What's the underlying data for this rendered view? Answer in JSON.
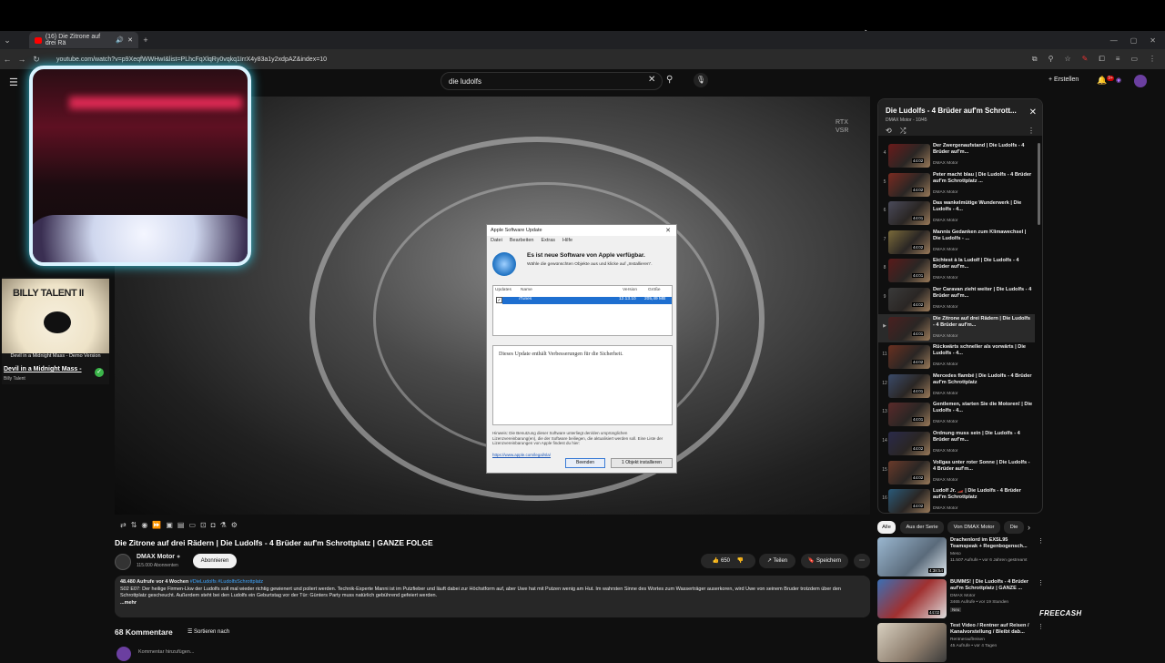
{
  "browser": {
    "tab_title": "(16) Die Zitrone auf drei Rä",
    "url": "youtube.com/watch?v=p9XeqfWWHwI&list=PLhcFqXlqRy0vqkq1IrrX4y83a1y2xdpAZ&index=10"
  },
  "header": {
    "search_value": "die ludolfs",
    "create_label": "Erstellen",
    "notif_count": "9+"
  },
  "music_widget": {
    "album_art_text": "BILLY TALENT II",
    "caption": "Devil in a Midnight Mass - Demo Version",
    "song_title": "Devil in a Midnight Mass -",
    "artist": "Billy Talent"
  },
  "video": {
    "rtx_label": "RTX\nVSR",
    "title": "Die Zitrone auf drei Rädern | Die Ludolfs - 4 Brüder auf'm Schrottplatz | GANZE FOLGE"
  },
  "dialog": {
    "window_title": "Apple Software Update",
    "menu": [
      "Datei",
      "Bearbeiten",
      "Extras",
      "Hilfe"
    ],
    "heading": "Es ist neue Software von Apple verfügbar.",
    "subheading": "Wähle die gewünschten Objekte aus und klicke auf „Installieren“.",
    "columns": [
      "Updates",
      "Name",
      "Version",
      "Größe"
    ],
    "row": {
      "name": "iTunes",
      "version": "12.13.10",
      "size": "205,49 MB"
    },
    "description": "Dieses Update enthält Verbesserungen für die Sicherheit.",
    "note": "Hinweis: Die Benutzung dieser Software unterliegt den/den ursprünglichen Lizenzvereinbarung(en), die der Software beiliegen, die aktualisiert werden soll. Eine Liste der Lizenzvereinbarungen von Apple findest du hier:",
    "link": "https://www.apple.com/legal/sla/",
    "quit_label": "Beenden",
    "install_label": "1 Objekt installieren"
  },
  "channel": {
    "name": "DMAX Motor",
    "subs": "115.000 Abonnenten",
    "subscribe_label": "Abonnieren"
  },
  "actions": {
    "like_count": "650",
    "share_label": "Teilen",
    "save_label": "Speichern"
  },
  "description": {
    "meta": "48.480 Aufrufe  vor 4 Wochen",
    "tags": "#DieLudolfs #LudolfsSchrottplatz",
    "text": "S02 E07: Der heilige Firmen-Lkw der Ludolfs soll mal wieder richtig gewienert und poliert werden. Technik-Experte Manni ist im Putzfieber und läuft dabei zur Höchstform auf, aber Uwe hat mit Putzen wenig am Hut. Im wahrsten Sinne des Wortes zum Wasserträger auserkoren, wird Uwe von seinem Bruder trotzdem über den Schrottplatz gescheucht. Außerdem steht bei den Ludolfs ein Geburtstag vor der Tür: Günters Party muss natürlich gebührend gefeiert werden.",
    "more": "...mehr"
  },
  "comments": {
    "count_label": "68 Kommentare",
    "sort_label": "Sortieren nach",
    "add_placeholder": "Kommentar hinzufügen..."
  },
  "playlist": {
    "title": "Die Ludolfs - 4 Brüder auf'm Schrott...",
    "subtitle": "DMAX Motor - 10/45",
    "items": [
      {
        "idx": "4",
        "title": "Der Zwergenaufstand | Die Ludolfs - 4 Brüder auf'm...",
        "channel": "DMAX Motor",
        "duration": "44:02"
      },
      {
        "idx": "5",
        "title": "Peter macht blau | Die Ludolfs - 4 Brüder auf'm Schrottplatz ...",
        "channel": "DMAX Motor",
        "duration": "44:02"
      },
      {
        "idx": "6",
        "title": "Das wankelmütige Wunderwerk | Die Ludolfs - 4...",
        "channel": "DMAX Motor",
        "duration": "44:01"
      },
      {
        "idx": "7",
        "title": "Mannis Gedanken zum Klimawechsel | Die Ludolfs - ...",
        "channel": "DMAX Motor",
        "duration": "44:02"
      },
      {
        "idx": "8",
        "title": "Eichtest à la Ludolf | Die Ludolfs - 4 Brüder auf'm...",
        "channel": "DMAX Motor",
        "duration": "44:01"
      },
      {
        "idx": "9",
        "title": "Der Caravan zieht weiter | Die Ludolfs - 4 Brüder auf'm...",
        "channel": "DMAX Motor",
        "duration": "44:02"
      },
      {
        "idx": "▶",
        "title": "Die Zitrone auf drei Rädern | Die Ludolfs - 4 Brüder auf'm...",
        "channel": "DMAX Motor",
        "duration": "44:01"
      },
      {
        "idx": "11",
        "title": "Rückwärts schneller als vorwärts | Die Ludolfs - 4...",
        "channel": "DMAX Motor",
        "duration": "44:02"
      },
      {
        "idx": "12",
        "title": "Mercedes flambé | Die Ludolfs - 4 Brüder auf'm Schrottplatz",
        "channel": "DMAX Motor",
        "duration": "44:01"
      },
      {
        "idx": "13",
        "title": "Gentlemen, starten Sie die Motoren! | Die Ludolfs - 4...",
        "channel": "DMAX Motor",
        "duration": "44:01"
      },
      {
        "idx": "14",
        "title": "Ordnung muss sein | Die Ludolfs - 4 Brüder auf'm...",
        "channel": "DMAX Motor",
        "duration": "44:02"
      },
      {
        "idx": "15",
        "title": "Vollgas unter roter Sonne | Die Ludolfs - 4 Brüder auf'm...",
        "channel": "DMAX Motor",
        "duration": "44:02"
      },
      {
        "idx": "16",
        "title": "Ludolf Jr. 🏎️ | Die Ludolfs - 4 Brüder auf'm Schrottplatz",
        "channel": "DMAX Motor",
        "duration": "44:02"
      }
    ]
  },
  "chips": [
    "Alle",
    "Aus der Serie",
    "Von DMAX Motor",
    "Die"
  ],
  "recommendations": [
    {
      "title": "Drachenlord im EXSL95 Teamspeak + Regenbogensch...",
      "channel": "Meso",
      "meta": "11.507 Aufrufe • vor 6 Jahren gestreamt",
      "duration": "4:38:54"
    },
    {
      "title": "BUMMS! | Die Ludolfs - 4 Brüder auf'm Schrottplatz | GANZE ...",
      "channel": "DMAX Motor",
      "meta": "3465 Aufrufe • vor 19 Stunden",
      "duration": "44:02",
      "badge": "Neu"
    },
    {
      "title": "Test Video / Rentner auf Reisen / Kanalvorstellung / Bleibt dab...",
      "channel": "Rentnerauflreisen",
      "meta": "45 Aufrufe • vor 4 Tagen",
      "duration": ""
    }
  ],
  "watermark": "FREECASH",
  "colors": {
    "accent": "#3ea6ff",
    "youtube_red": "#ff0000",
    "dialog_select": "#1e6fd0"
  }
}
